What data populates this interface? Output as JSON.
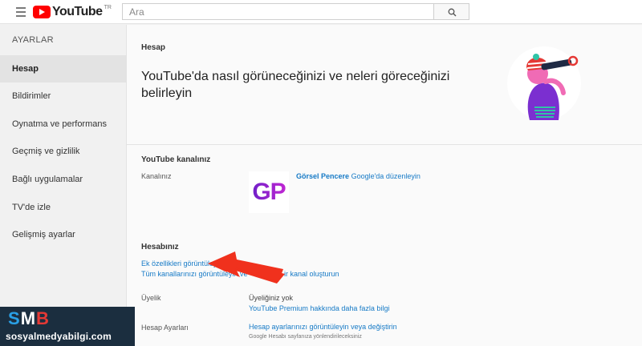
{
  "header": {
    "logo_text": "YouTube",
    "logo_region": "TR",
    "search_placeholder": "Ara"
  },
  "sidebar": {
    "title": "AYARLAR",
    "items": [
      {
        "label": "Hesap",
        "active": true
      },
      {
        "label": "Bildirimler"
      },
      {
        "label": "Oynatma ve performans"
      },
      {
        "label": "Geçmiş ve gizlilik"
      },
      {
        "label": "Bağlı uygulamalar"
      },
      {
        "label": "TV'de izle"
      },
      {
        "label": "Gelişmiş ayarlar"
      }
    ]
  },
  "main": {
    "page_title": "Hesap",
    "headline": "YouTube'da nasıl görüneceğinizi ve neleri göreceğinizi belirleyin",
    "channel_section": {
      "title": "YouTube kanalınız",
      "label": "Kanalınız",
      "avatar_text": "GP",
      "channel_name": "Görsel Pencere",
      "edit_link": "Google'da düzenleyin"
    },
    "account_section": {
      "title": "Hesabınız",
      "link_extra": "Ek özellikleri görüntüleyin",
      "link_channels_start": "Tüm kanallarınızı görüntüleyin ve",
      "link_channels_end": "ir kanal oluşturun",
      "membership_label": "Üyelik",
      "membership_value": "Üyeliğiniz yok",
      "premium_link": "YouTube Premium hakkında daha fazla bilgi",
      "account_settings_label": "Hesap Ayarları",
      "account_settings_link": "Hesap ayarlarınızı görüntüleyin veya değiştirin",
      "account_settings_note": "Google Hesabı sayfanıza yönlendirileceksiniz"
    }
  },
  "watermark": {
    "letters": [
      "S",
      "M",
      "B"
    ],
    "letter_colors": [
      "#2aa0e6",
      "#ffffff",
      "#e53935"
    ],
    "url": "sosyalmedyabilgi.com"
  },
  "colors": {
    "link": "#167ac6",
    "arrow": "#f0311d",
    "brand_red": "#ff0000"
  }
}
